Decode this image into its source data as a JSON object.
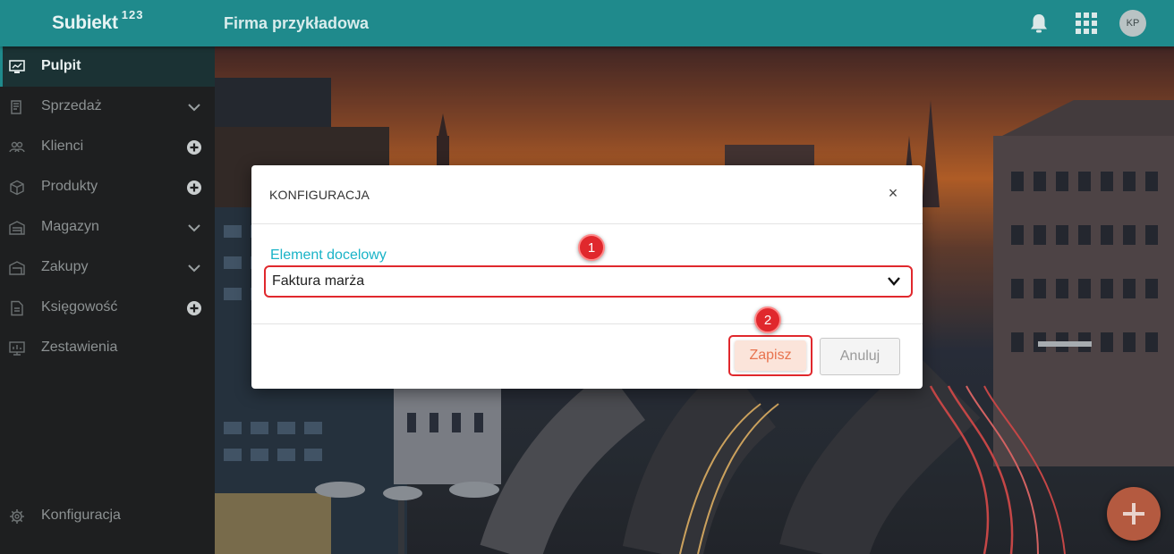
{
  "header": {
    "logo": "Subiekt",
    "logo_sup": "123",
    "company": "Firma przykładowa",
    "avatar_initials": "KP"
  },
  "sidebar": {
    "items": [
      {
        "label": "Pulpit",
        "icon": "monitor-icon",
        "trail": "",
        "active": true
      },
      {
        "label": "Sprzedaż",
        "icon": "sales-icon",
        "trail": "chevron-down-icon"
      },
      {
        "label": "Klienci",
        "icon": "clients-icon",
        "trail": "plus-circle-icon"
      },
      {
        "label": "Produkty",
        "icon": "box-icon",
        "trail": "plus-circle-icon"
      },
      {
        "label": "Magazyn",
        "icon": "warehouse-icon",
        "trail": "chevron-down-icon"
      },
      {
        "label": "Zakupy",
        "icon": "purchase-icon",
        "trail": "chevron-down-icon"
      },
      {
        "label": "Księgowość",
        "icon": "accounting-icon",
        "trail": "plus-circle-icon"
      },
      {
        "label": "Zestawienia",
        "icon": "reports-icon",
        "trail": ""
      }
    ],
    "bottom": {
      "label": "Konfiguracja",
      "icon": "gear-icon"
    }
  },
  "modal": {
    "title": "KONFIGURACJA",
    "close": "×",
    "field_label": "Element docelowy",
    "field_value": "Faktura marża",
    "save_label": "Zapisz",
    "cancel_label": "Anuluj"
  },
  "badges": {
    "one": "1",
    "two": "2"
  },
  "colors": {
    "accent": "#1f8a8c",
    "label": "#19b3c7",
    "highlight": "#e0282d",
    "save_text": "#e8734e"
  }
}
